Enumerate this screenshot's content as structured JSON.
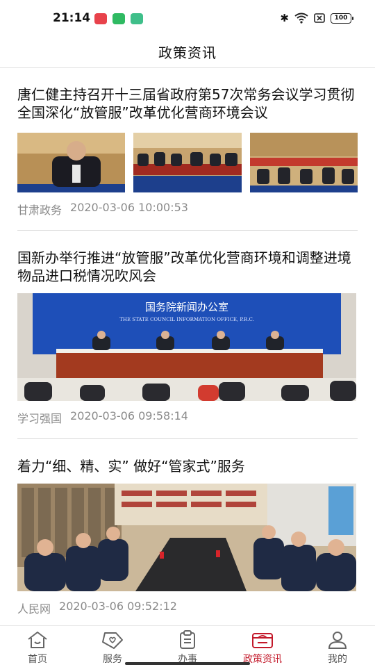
{
  "status": {
    "time": "21:14",
    "battery": "100"
  },
  "header": {
    "title": "政策资讯"
  },
  "articles": [
    {
      "headline": "唐仁健主持召开十三届省政府第57次常务会议学习贯彻全国深化“放管服”改革优化营商环境会议",
      "source": "甘肃政务",
      "time": "2020-03-06 10:00:53"
    },
    {
      "headline": "国新办举行推进“放管服”改革优化营商环境和调整进境物品进口税情况吹风会",
      "source": "学习强国",
      "time": "2020-03-06 09:58:14",
      "image_banner": "国务院新闻办公室",
      "image_banner_en": "THE STATE COUNCIL INFORMATION OFFICE, P.R.C."
    },
    {
      "headline": "着力“细、精、实” 做好“管家式”服务",
      "source": "人民网",
      "time": "2020-03-06 09:52:12"
    }
  ],
  "tabs": [
    {
      "label": "首页",
      "icon": "home-icon"
    },
    {
      "label": "服务",
      "icon": "heart-tag-icon"
    },
    {
      "label": "办事",
      "icon": "clipboard-icon"
    },
    {
      "label": "政策资讯",
      "icon": "policy-box-icon"
    },
    {
      "label": "我的",
      "icon": "user-icon"
    }
  ],
  "colors": {
    "accent": "#c3192a",
    "meta": "#8a8a8a"
  }
}
